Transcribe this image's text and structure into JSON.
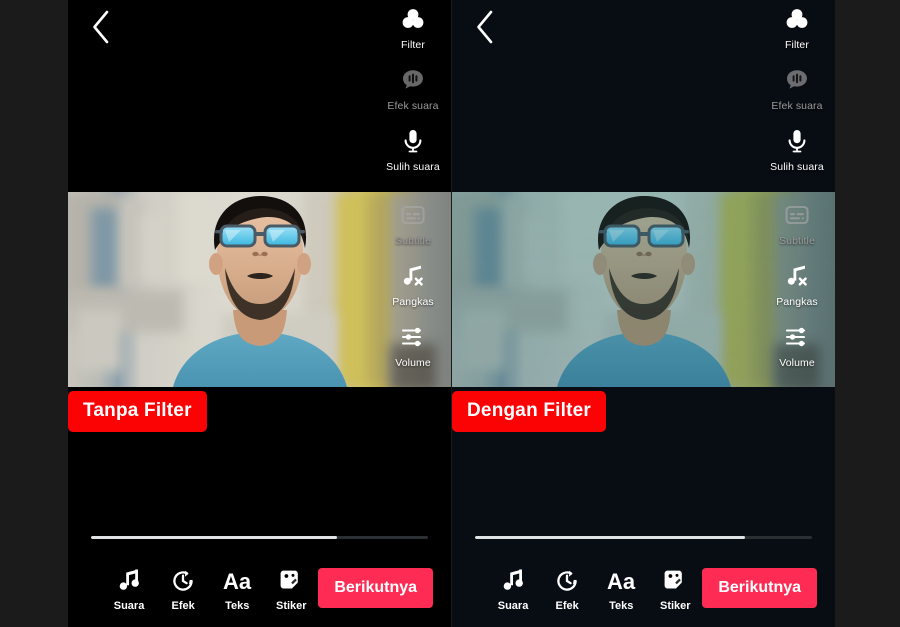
{
  "theme": {
    "page_bg": "#1b1b1b",
    "panel_left_bg": "#000000",
    "panel_right_bg": "#080d13",
    "badge_red": "#fb0205",
    "next_button_red": "#fe2c55",
    "label_white": "#ffffff",
    "label_dim": "#9a9a9a"
  },
  "panels": [
    {
      "id": "left",
      "caption": "Tanpa Filter",
      "filtered": false,
      "back_icon": "chevron-left-icon",
      "progress_percent": 73,
      "side_tools_top": [
        {
          "label": "Filter",
          "icon": "filter-circles-icon",
          "enabled": true
        },
        {
          "label": "Efek suara",
          "icon": "sound-effect-bubble-icon",
          "enabled": false
        },
        {
          "label": "Sulih suara",
          "icon": "microphone-icon",
          "enabled": true
        }
      ],
      "side_tools_bottom": [
        {
          "label": "Subtitle",
          "icon": "subtitle-icon",
          "enabled": false
        },
        {
          "label": "Pangkas",
          "icon": "music-note-cut-icon",
          "enabled": true
        },
        {
          "label": "Volume",
          "icon": "sliders-icon",
          "enabled": true
        }
      ],
      "bottom_tools": [
        {
          "label": "Suara",
          "icon": "music-note-icon"
        },
        {
          "label": "Efek",
          "icon": "clock-effect-icon"
        },
        {
          "label": "Teks",
          "icon": "text-aa-icon"
        },
        {
          "label": "Stiker",
          "icon": "sticker-icon"
        }
      ],
      "next_label": "Berikutnya"
    },
    {
      "id": "right",
      "caption": "Dengan Filter",
      "filtered": true,
      "back_icon": "chevron-left-icon",
      "progress_percent": 80,
      "side_tools_top": [
        {
          "label": "Filter",
          "icon": "filter-circles-icon",
          "enabled": true
        },
        {
          "label": "Efek suara",
          "icon": "sound-effect-bubble-icon",
          "enabled": false
        },
        {
          "label": "Sulih suara",
          "icon": "microphone-icon",
          "enabled": true
        }
      ],
      "side_tools_bottom": [
        {
          "label": "Subtitle",
          "icon": "subtitle-icon",
          "enabled": false
        },
        {
          "label": "Pangkas",
          "icon": "music-note-cut-icon",
          "enabled": true
        },
        {
          "label": "Volume",
          "icon": "sliders-icon",
          "enabled": true
        }
      ],
      "bottom_tools": [
        {
          "label": "Suara",
          "icon": "music-note-icon"
        },
        {
          "label": "Efek",
          "icon": "clock-effect-icon"
        },
        {
          "label": "Teks",
          "icon": "text-aa-icon"
        },
        {
          "label": "Stiker",
          "icon": "sticker-icon"
        }
      ],
      "next_label": "Berikutnya"
    }
  ]
}
